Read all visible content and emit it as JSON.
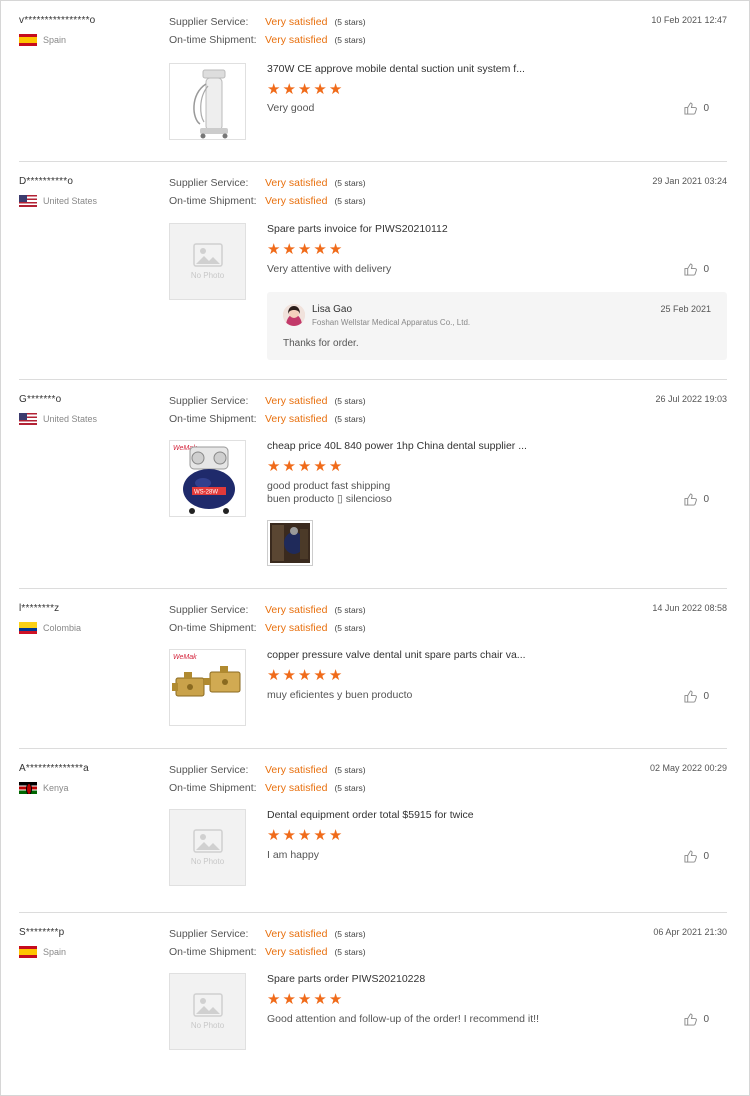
{
  "labels": {
    "supplier_service": "Supplier Service:",
    "on_time_shipment": "On-time Shipment:"
  },
  "reviews": [
    {
      "name": "v****************o",
      "country": "Spain",
      "flag": "es",
      "supplier_service": "Very satisfied",
      "supplier_stars": "(5 stars)",
      "shipment": "Very satisfied",
      "shipment_stars": "(5 stars)",
      "date": "10 Feb 2021 12:47",
      "product": "370W CE approve mobile dental suction unit system f...",
      "rating": 5,
      "comment": "Very good",
      "likes": "0",
      "image": "suction-unit"
    },
    {
      "name": "D**********o",
      "country": "United States",
      "flag": "us",
      "supplier_service": "Very satisfied",
      "supplier_stars": "(5 stars)",
      "shipment": "Very satisfied",
      "shipment_stars": "(5 stars)",
      "date": "29 Jan 2021 03:24",
      "product": "Spare parts invoice for PIWS20210112",
      "rating": 5,
      "comment": "Very attentive with delivery",
      "likes": "0",
      "image": "no-photo",
      "no_photo_label": "No Photo",
      "reply": {
        "name": "Lisa Gao",
        "company": "Foshan Wellstar Medical Apparatus Co., Ltd.",
        "date": "25 Feb 2021",
        "text": "Thanks for order."
      }
    },
    {
      "name": "G*******o",
      "country": "United States",
      "flag": "us",
      "supplier_service": "Very satisfied",
      "supplier_stars": "(5 stars)",
      "shipment": "Very satisfied",
      "shipment_stars": "(5 stars)",
      "date": "26 Jul 2022 19:03",
      "product": "cheap price 40L 840 power 1hp China dental supplier ...",
      "rating": 5,
      "comment_line1": "good product fast shipping",
      "comment_line2": "buen producto ▯ silencioso",
      "likes": "0",
      "image": "compressor",
      "image_brand": "WeMak",
      "image_badge": "WS-28W"
    },
    {
      "name": "l********z",
      "country": "Colombia",
      "flag": "co",
      "supplier_service": "Very satisfied",
      "supplier_stars": "(5 stars)",
      "shipment": "Very satisfied",
      "shipment_stars": "(5 stars)",
      "date": "14 Jun 2022 08:58",
      "product": "copper pressure valve dental unit spare parts chair va...",
      "rating": 5,
      "comment": "muy eficientes y buen producto",
      "likes": "0",
      "image": "valve",
      "image_brand": "WeMak"
    },
    {
      "name": "A**************a",
      "country": "Kenya",
      "flag": "ke",
      "supplier_service": "Very satisfied",
      "supplier_stars": "(5 stars)",
      "shipment": "Very satisfied",
      "shipment_stars": "(5 stars)",
      "date": "02 May 2022 00:29",
      "product": "Dental equipment order total $5915 for twice",
      "rating": 5,
      "comment": "I am happy",
      "likes": "0",
      "image": "no-photo",
      "no_photo_label": "No Photo"
    },
    {
      "name": "S********p",
      "country": "Spain",
      "flag": "es",
      "supplier_service": "Very satisfied",
      "supplier_stars": "(5 stars)",
      "shipment": "Very satisfied",
      "shipment_stars": "(5 stars)",
      "date": "06 Apr 2021 21:30",
      "product": "Spare parts order PIWS20210228",
      "rating": 5,
      "comment": "Good attention and follow-up of the order! I recommend it!!",
      "likes": "0",
      "image": "no-photo",
      "no_photo_label": "No Photo"
    }
  ],
  "colors": {
    "accent": "#f06b1a",
    "satisfied": "#e8700e"
  }
}
